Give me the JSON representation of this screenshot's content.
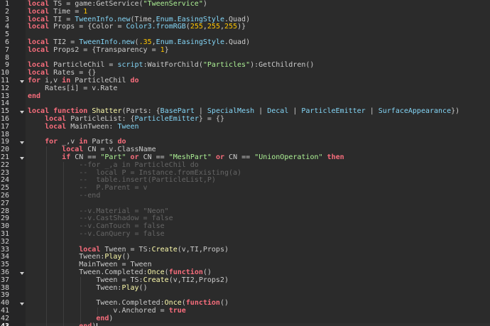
{
  "editor": {
    "current_line": 43,
    "lines": [
      {
        "n": 1,
        "fold": false,
        "tokens": [
          [
            "kw",
            "local"
          ],
          [
            "tx",
            " TS = game:GetService("
          ],
          [
            "str",
            "\"TweenService\""
          ],
          [
            "tx",
            ")"
          ]
        ]
      },
      {
        "n": 2,
        "fold": false,
        "tokens": [
          [
            "kw",
            "local"
          ],
          [
            "tx",
            " Time = "
          ],
          [
            "num",
            "1"
          ]
        ]
      },
      {
        "n": 3,
        "fold": false,
        "tokens": [
          [
            "kw",
            "local"
          ],
          [
            "tx",
            " TI = "
          ],
          [
            "bi",
            "TweenInfo.new"
          ],
          [
            "tx",
            "(Time,"
          ],
          [
            "bi",
            "Enum.EasingStyle"
          ],
          [
            "tx",
            ".Quad)"
          ]
        ]
      },
      {
        "n": 4,
        "fold": false,
        "tokens": [
          [
            "kw",
            "local"
          ],
          [
            "tx",
            " Props = {Color = "
          ],
          [
            "bi",
            "Color3.fromRGB"
          ],
          [
            "tx",
            "("
          ],
          [
            "num",
            "255"
          ],
          [
            "tx",
            ","
          ],
          [
            "num",
            "255"
          ],
          [
            "tx",
            ","
          ],
          [
            "num",
            "255"
          ],
          [
            "tx",
            ")}"
          ]
        ]
      },
      {
        "n": 5,
        "fold": false,
        "tokens": []
      },
      {
        "n": 6,
        "fold": false,
        "tokens": [
          [
            "kw",
            "local"
          ],
          [
            "tx",
            " TI2 = "
          ],
          [
            "bi",
            "TweenInfo.new"
          ],
          [
            "tx",
            "("
          ],
          [
            "num",
            ".35"
          ],
          [
            "tx",
            ","
          ],
          [
            "bi",
            "Enum.EasingStyle"
          ],
          [
            "tx",
            ".Quad)"
          ]
        ]
      },
      {
        "n": 7,
        "fold": false,
        "tokens": [
          [
            "kw",
            "local"
          ],
          [
            "tx",
            " Props2 = {Transparency = "
          ],
          [
            "num",
            "1"
          ],
          [
            "tx",
            "}"
          ]
        ]
      },
      {
        "n": 8,
        "fold": false,
        "tokens": []
      },
      {
        "n": 9,
        "fold": false,
        "tokens": [
          [
            "kw",
            "local"
          ],
          [
            "tx",
            " ParticleChil = "
          ],
          [
            "bi",
            "script"
          ],
          [
            "tx",
            ":WaitForChild("
          ],
          [
            "str",
            "\"Particles\""
          ],
          [
            "tx",
            "):GetChildren()"
          ]
        ]
      },
      {
        "n": 10,
        "fold": false,
        "tokens": [
          [
            "kw",
            "local"
          ],
          [
            "tx",
            " Rates = {}"
          ]
        ]
      },
      {
        "n": 11,
        "fold": true,
        "tokens": [
          [
            "kw",
            "for"
          ],
          [
            "tx",
            " i,v "
          ],
          [
            "kw",
            "in"
          ],
          [
            "tx",
            " ParticleChil "
          ],
          [
            "kw",
            "do"
          ]
        ]
      },
      {
        "n": 12,
        "fold": false,
        "tokens": [
          [
            "tx",
            "    Rates[i] = v.Rate"
          ]
        ]
      },
      {
        "n": 13,
        "fold": false,
        "tokens": [
          [
            "kw",
            "end"
          ]
        ]
      },
      {
        "n": 14,
        "fold": false,
        "tokens": []
      },
      {
        "n": 15,
        "fold": true,
        "tokens": [
          [
            "kw",
            "local function"
          ],
          [
            "tx",
            " "
          ],
          [
            "fn",
            "Shatter"
          ],
          [
            "tx",
            "(Parts: {"
          ],
          [
            "bi",
            "BasePart"
          ],
          [
            "tx",
            " | "
          ],
          [
            "bi",
            "SpecialMesh"
          ],
          [
            "tx",
            " | "
          ],
          [
            "bi",
            "Decal"
          ],
          [
            "tx",
            " | "
          ],
          [
            "bi",
            "ParticleEmitter"
          ],
          [
            "tx",
            " | "
          ],
          [
            "bi",
            "SurfaceAppearance"
          ],
          [
            "tx",
            "})"
          ]
        ]
      },
      {
        "n": 16,
        "fold": false,
        "tokens": [
          [
            "tx",
            "    "
          ],
          [
            "kw",
            "local"
          ],
          [
            "tx",
            " ParticleList: {"
          ],
          [
            "bi",
            "ParticleEmitter"
          ],
          [
            "tx",
            "} = {}"
          ]
        ]
      },
      {
        "n": 17,
        "fold": false,
        "tokens": [
          [
            "tx",
            "    "
          ],
          [
            "kw",
            "local"
          ],
          [
            "tx",
            " MainTween: "
          ],
          [
            "bi",
            "Tween"
          ]
        ]
      },
      {
        "n": 18,
        "fold": false,
        "tokens": []
      },
      {
        "n": 19,
        "fold": true,
        "tokens": [
          [
            "tx",
            "    "
          ],
          [
            "kw",
            "for"
          ],
          [
            "tx",
            " _,v "
          ],
          [
            "kw",
            "in"
          ],
          [
            "tx",
            " Parts "
          ],
          [
            "kw",
            "do"
          ]
        ]
      },
      {
        "n": 20,
        "fold": false,
        "tokens": [
          [
            "tx",
            "        "
          ],
          [
            "kw",
            "local"
          ],
          [
            "tx",
            " CN = v.ClassName"
          ]
        ]
      },
      {
        "n": 21,
        "fold": true,
        "tokens": [
          [
            "tx",
            "        "
          ],
          [
            "kw",
            "if"
          ],
          [
            "tx",
            " CN == "
          ],
          [
            "str",
            "\"Part\""
          ],
          [
            "tx",
            " "
          ],
          [
            "kw",
            "or"
          ],
          [
            "tx",
            " CN == "
          ],
          [
            "str",
            "\"MeshPart\""
          ],
          [
            "tx",
            " "
          ],
          [
            "kw",
            "or"
          ],
          [
            "tx",
            " CN == "
          ],
          [
            "str",
            "\"UnionOperation\""
          ],
          [
            "tx",
            " "
          ],
          [
            "kw",
            "then"
          ]
        ]
      },
      {
        "n": 22,
        "fold": false,
        "tokens": [
          [
            "cm",
            "            --for _,a in ParticleChil do"
          ]
        ]
      },
      {
        "n": 23,
        "fold": false,
        "tokens": [
          [
            "cm",
            "            --  local P = Instance.fromExisting(a)"
          ]
        ]
      },
      {
        "n": 24,
        "fold": false,
        "tokens": [
          [
            "cm",
            "            --  table.insert(ParticleList,P)"
          ]
        ]
      },
      {
        "n": 25,
        "fold": false,
        "tokens": [
          [
            "cm",
            "            --  P.Parent = v"
          ]
        ]
      },
      {
        "n": 26,
        "fold": false,
        "tokens": [
          [
            "cm",
            "            --end"
          ]
        ]
      },
      {
        "n": 27,
        "fold": false,
        "tokens": []
      },
      {
        "n": 28,
        "fold": false,
        "tokens": [
          [
            "cm",
            "            --v.Material = \"Neon\""
          ]
        ]
      },
      {
        "n": 29,
        "fold": false,
        "tokens": [
          [
            "cm",
            "            --v.CastShadow = false"
          ]
        ]
      },
      {
        "n": 30,
        "fold": false,
        "tokens": [
          [
            "cm",
            "            --v.CanTouch = false"
          ]
        ]
      },
      {
        "n": 31,
        "fold": false,
        "tokens": [
          [
            "cm",
            "            --v.CanQuery = false"
          ]
        ]
      },
      {
        "n": 32,
        "fold": false,
        "tokens": []
      },
      {
        "n": 33,
        "fold": false,
        "tokens": [
          [
            "tx",
            "            "
          ],
          [
            "kw",
            "local"
          ],
          [
            "tx",
            " Tween = TS:"
          ],
          [
            "fn",
            "Create"
          ],
          [
            "tx",
            "(v,TI,Props)"
          ]
        ]
      },
      {
        "n": 34,
        "fold": false,
        "tokens": [
          [
            "tx",
            "            Tween:"
          ],
          [
            "fn",
            "Play"
          ],
          [
            "tx",
            "()"
          ]
        ]
      },
      {
        "n": 35,
        "fold": false,
        "tokens": [
          [
            "tx",
            "            MainTween = Tween"
          ]
        ]
      },
      {
        "n": 36,
        "fold": true,
        "tokens": [
          [
            "tx",
            "            Tween.Completed:"
          ],
          [
            "fn",
            "Once"
          ],
          [
            "tx",
            "("
          ],
          [
            "kw",
            "function"
          ],
          [
            "tx",
            "()"
          ]
        ]
      },
      {
        "n": 37,
        "fold": false,
        "tokens": [
          [
            "tx",
            "                Tween = TS:"
          ],
          [
            "fn",
            "Create"
          ],
          [
            "tx",
            "(v,TI2,Props2)"
          ]
        ]
      },
      {
        "n": 38,
        "fold": false,
        "tokens": [
          [
            "tx",
            "                Tween:"
          ],
          [
            "fn",
            "Play"
          ],
          [
            "tx",
            "()"
          ]
        ]
      },
      {
        "n": 39,
        "fold": false,
        "tokens": []
      },
      {
        "n": 40,
        "fold": true,
        "tokens": [
          [
            "tx",
            "                Tween.Completed:"
          ],
          [
            "fn",
            "Once"
          ],
          [
            "tx",
            "("
          ],
          [
            "kw",
            "function"
          ],
          [
            "tx",
            "()"
          ]
        ]
      },
      {
        "n": 41,
        "fold": false,
        "tokens": [
          [
            "tx",
            "                    v.Anchored = "
          ],
          [
            "kw",
            "true"
          ]
        ]
      },
      {
        "n": 42,
        "fold": false,
        "tokens": [
          [
            "tx",
            "                "
          ],
          [
            "kw",
            "end"
          ],
          [
            "tx",
            ")"
          ]
        ]
      },
      {
        "n": 43,
        "fold": false,
        "tokens": [
          [
            "tx",
            "            "
          ],
          [
            "kw",
            "end"
          ],
          [
            "tx",
            ")"
          ]
        ]
      }
    ]
  }
}
